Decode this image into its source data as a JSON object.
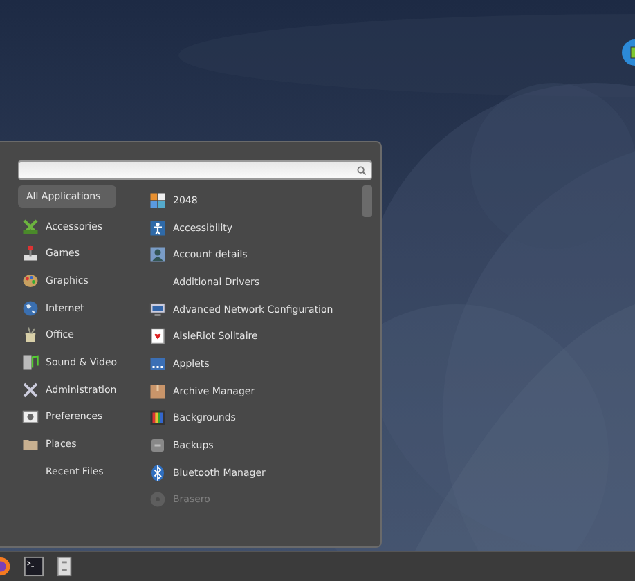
{
  "menu": {
    "categories": [
      {
        "label": "All Applications",
        "selected": true
      },
      {
        "label": "Accessories",
        "selected": false
      },
      {
        "label": "Games",
        "selected": false
      },
      {
        "label": "Graphics",
        "selected": false
      },
      {
        "label": "Internet",
        "selected": false
      },
      {
        "label": "Office",
        "selected": false
      },
      {
        "label": "Sound & Video",
        "selected": false
      },
      {
        "label": "Administration",
        "selected": false
      },
      {
        "label": "Preferences",
        "selected": false
      },
      {
        "label": "Places",
        "selected": false
      },
      {
        "label": "Recent Files",
        "selected": false
      }
    ],
    "applications": [
      {
        "label": "2048",
        "faded": false
      },
      {
        "label": "Accessibility",
        "faded": false
      },
      {
        "label": "Account details",
        "faded": false
      },
      {
        "label": "Additional Drivers",
        "faded": false
      },
      {
        "label": "Advanced Network Configuration",
        "faded": false
      },
      {
        "label": "AisleRiot Solitaire",
        "faded": false
      },
      {
        "label": "Applets",
        "faded": false
      },
      {
        "label": "Archive Manager",
        "faded": false
      },
      {
        "label": "Backgrounds",
        "faded": false
      },
      {
        "label": "Backups",
        "faded": false
      },
      {
        "label": "Bluetooth Manager",
        "faded": false
      },
      {
        "label": "Brasero",
        "faded": true
      }
    ]
  }
}
